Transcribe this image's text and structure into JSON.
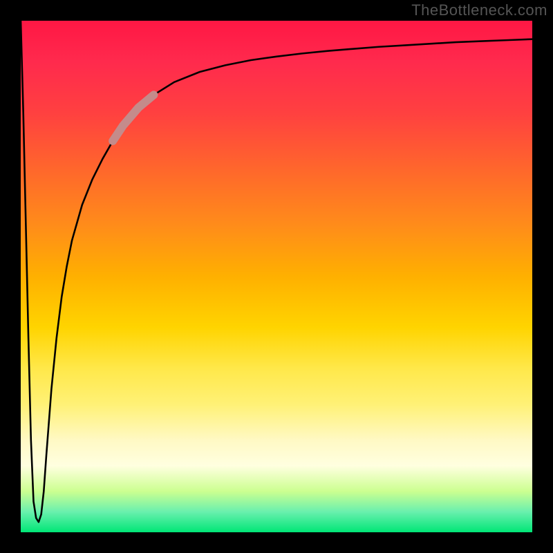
{
  "watermark": "TheBottleneck.com",
  "chart_data": {
    "type": "line",
    "title": "",
    "xlabel": "",
    "ylabel": "",
    "xlim": [
      0,
      100
    ],
    "ylim": [
      0,
      100
    ],
    "grid": false,
    "series": [
      {
        "name": "curve",
        "x": [
          0.0,
          0.5,
          1.0,
          1.5,
          2.0,
          2.5,
          3.0,
          3.5,
          4.0,
          4.5,
          5.0,
          6.0,
          7.0,
          8.0,
          9.0,
          10.0,
          12.0,
          14.0,
          16.0,
          18.0,
          20.0,
          23.0,
          26.0,
          30.0,
          35.0,
          40.0,
          45.0,
          50.0,
          55.0,
          60.0,
          65.0,
          70.0,
          75.0,
          80.0,
          85.0,
          90.0,
          95.0,
          100.0
        ],
        "y": [
          100.0,
          82.0,
          60.0,
          38.0,
          18.0,
          6.0,
          2.8,
          2.0,
          3.5,
          8.0,
          15.0,
          28.0,
          38.0,
          46.0,
          52.0,
          57.0,
          64.0,
          69.0,
          73.0,
          76.5,
          79.5,
          83.0,
          85.5,
          88.0,
          90.0,
          91.3,
          92.3,
          93.0,
          93.6,
          94.1,
          94.5,
          94.9,
          95.2,
          95.5,
          95.8,
          96.0,
          96.2,
          96.4
        ]
      },
      {
        "name": "highlight-segment",
        "x": [
          18.0,
          20.0,
          23.0,
          26.0
        ],
        "y": [
          76.5,
          79.5,
          83.0,
          85.5
        ]
      }
    ],
    "background_gradient": {
      "top_color": "#ff1744",
      "bottom_color": "#00e676"
    },
    "highlight_color": "#c48b8b"
  }
}
